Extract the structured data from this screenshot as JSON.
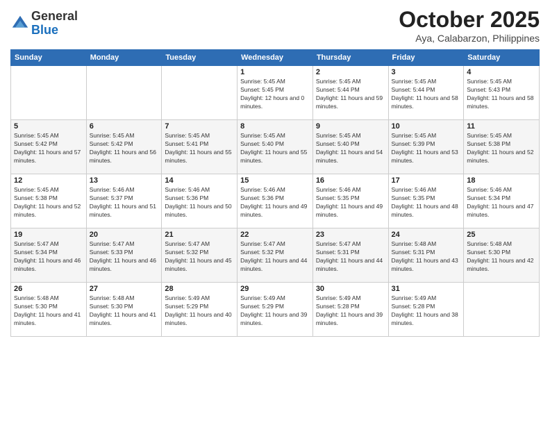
{
  "header": {
    "logo": {
      "line1": "General",
      "line2": "Blue"
    },
    "title": "October 2025",
    "subtitle": "Aya, Calabarzon, Philippines"
  },
  "weekdays": [
    "Sunday",
    "Monday",
    "Tuesday",
    "Wednesday",
    "Thursday",
    "Friday",
    "Saturday"
  ],
  "weeks": [
    [
      {
        "day": "",
        "sunrise": "",
        "sunset": "",
        "daylight": ""
      },
      {
        "day": "",
        "sunrise": "",
        "sunset": "",
        "daylight": ""
      },
      {
        "day": "",
        "sunrise": "",
        "sunset": "",
        "daylight": ""
      },
      {
        "day": "1",
        "sunrise": "Sunrise: 5:45 AM",
        "sunset": "Sunset: 5:45 PM",
        "daylight": "Daylight: 12 hours and 0 minutes."
      },
      {
        "day": "2",
        "sunrise": "Sunrise: 5:45 AM",
        "sunset": "Sunset: 5:44 PM",
        "daylight": "Daylight: 11 hours and 59 minutes."
      },
      {
        "day": "3",
        "sunrise": "Sunrise: 5:45 AM",
        "sunset": "Sunset: 5:44 PM",
        "daylight": "Daylight: 11 hours and 58 minutes."
      },
      {
        "day": "4",
        "sunrise": "Sunrise: 5:45 AM",
        "sunset": "Sunset: 5:43 PM",
        "daylight": "Daylight: 11 hours and 58 minutes."
      }
    ],
    [
      {
        "day": "5",
        "sunrise": "Sunrise: 5:45 AM",
        "sunset": "Sunset: 5:42 PM",
        "daylight": "Daylight: 11 hours and 57 minutes."
      },
      {
        "day": "6",
        "sunrise": "Sunrise: 5:45 AM",
        "sunset": "Sunset: 5:42 PM",
        "daylight": "Daylight: 11 hours and 56 minutes."
      },
      {
        "day": "7",
        "sunrise": "Sunrise: 5:45 AM",
        "sunset": "Sunset: 5:41 PM",
        "daylight": "Daylight: 11 hours and 55 minutes."
      },
      {
        "day": "8",
        "sunrise": "Sunrise: 5:45 AM",
        "sunset": "Sunset: 5:40 PM",
        "daylight": "Daylight: 11 hours and 55 minutes."
      },
      {
        "day": "9",
        "sunrise": "Sunrise: 5:45 AM",
        "sunset": "Sunset: 5:40 PM",
        "daylight": "Daylight: 11 hours and 54 minutes."
      },
      {
        "day": "10",
        "sunrise": "Sunrise: 5:45 AM",
        "sunset": "Sunset: 5:39 PM",
        "daylight": "Daylight: 11 hours and 53 minutes."
      },
      {
        "day": "11",
        "sunrise": "Sunrise: 5:45 AM",
        "sunset": "Sunset: 5:38 PM",
        "daylight": "Daylight: 11 hours and 52 minutes."
      }
    ],
    [
      {
        "day": "12",
        "sunrise": "Sunrise: 5:45 AM",
        "sunset": "Sunset: 5:38 PM",
        "daylight": "Daylight: 11 hours and 52 minutes."
      },
      {
        "day": "13",
        "sunrise": "Sunrise: 5:46 AM",
        "sunset": "Sunset: 5:37 PM",
        "daylight": "Daylight: 11 hours and 51 minutes."
      },
      {
        "day": "14",
        "sunrise": "Sunrise: 5:46 AM",
        "sunset": "Sunset: 5:36 PM",
        "daylight": "Daylight: 11 hours and 50 minutes."
      },
      {
        "day": "15",
        "sunrise": "Sunrise: 5:46 AM",
        "sunset": "Sunset: 5:36 PM",
        "daylight": "Daylight: 11 hours and 49 minutes."
      },
      {
        "day": "16",
        "sunrise": "Sunrise: 5:46 AM",
        "sunset": "Sunset: 5:35 PM",
        "daylight": "Daylight: 11 hours and 49 minutes."
      },
      {
        "day": "17",
        "sunrise": "Sunrise: 5:46 AM",
        "sunset": "Sunset: 5:35 PM",
        "daylight": "Daylight: 11 hours and 48 minutes."
      },
      {
        "day": "18",
        "sunrise": "Sunrise: 5:46 AM",
        "sunset": "Sunset: 5:34 PM",
        "daylight": "Daylight: 11 hours and 47 minutes."
      }
    ],
    [
      {
        "day": "19",
        "sunrise": "Sunrise: 5:47 AM",
        "sunset": "Sunset: 5:34 PM",
        "daylight": "Daylight: 11 hours and 46 minutes."
      },
      {
        "day": "20",
        "sunrise": "Sunrise: 5:47 AM",
        "sunset": "Sunset: 5:33 PM",
        "daylight": "Daylight: 11 hours and 46 minutes."
      },
      {
        "day": "21",
        "sunrise": "Sunrise: 5:47 AM",
        "sunset": "Sunset: 5:32 PM",
        "daylight": "Daylight: 11 hours and 45 minutes."
      },
      {
        "day": "22",
        "sunrise": "Sunrise: 5:47 AM",
        "sunset": "Sunset: 5:32 PM",
        "daylight": "Daylight: 11 hours and 44 minutes."
      },
      {
        "day": "23",
        "sunrise": "Sunrise: 5:47 AM",
        "sunset": "Sunset: 5:31 PM",
        "daylight": "Daylight: 11 hours and 44 minutes."
      },
      {
        "day": "24",
        "sunrise": "Sunrise: 5:48 AM",
        "sunset": "Sunset: 5:31 PM",
        "daylight": "Daylight: 11 hours and 43 minutes."
      },
      {
        "day": "25",
        "sunrise": "Sunrise: 5:48 AM",
        "sunset": "Sunset: 5:30 PM",
        "daylight": "Daylight: 11 hours and 42 minutes."
      }
    ],
    [
      {
        "day": "26",
        "sunrise": "Sunrise: 5:48 AM",
        "sunset": "Sunset: 5:30 PM",
        "daylight": "Daylight: 11 hours and 41 minutes."
      },
      {
        "day": "27",
        "sunrise": "Sunrise: 5:48 AM",
        "sunset": "Sunset: 5:30 PM",
        "daylight": "Daylight: 11 hours and 41 minutes."
      },
      {
        "day": "28",
        "sunrise": "Sunrise: 5:49 AM",
        "sunset": "Sunset: 5:29 PM",
        "daylight": "Daylight: 11 hours and 40 minutes."
      },
      {
        "day": "29",
        "sunrise": "Sunrise: 5:49 AM",
        "sunset": "Sunset: 5:29 PM",
        "daylight": "Daylight: 11 hours and 39 minutes."
      },
      {
        "day": "30",
        "sunrise": "Sunrise: 5:49 AM",
        "sunset": "Sunset: 5:28 PM",
        "daylight": "Daylight: 11 hours and 39 minutes."
      },
      {
        "day": "31",
        "sunrise": "Sunrise: 5:49 AM",
        "sunset": "Sunset: 5:28 PM",
        "daylight": "Daylight: 11 hours and 38 minutes."
      },
      {
        "day": "",
        "sunrise": "",
        "sunset": "",
        "daylight": ""
      }
    ]
  ]
}
